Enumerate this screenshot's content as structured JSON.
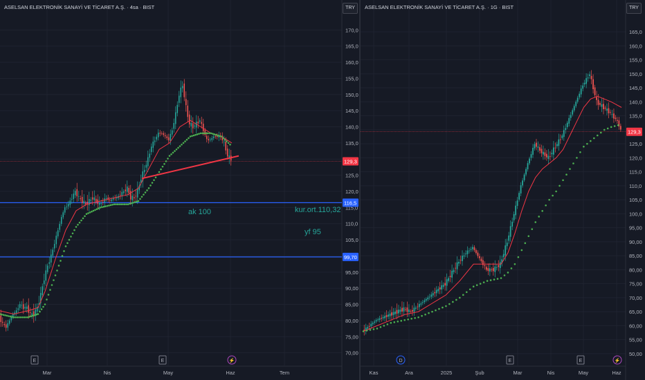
{
  "chart_data": [
    {
      "type": "candlestick",
      "title": "ASELSAN ELEKTRONİK SANAYİ VE TİCARET A.Ş. · 4sa · BIST",
      "currency": "TRY",
      "y_ticks": [
        "70,00",
        "75,00",
        "80,00",
        "85,00",
        "90,00",
        "95,00",
        "100,0",
        "105,0",
        "110,0",
        "115,0",
        "120,0",
        "125,0",
        "130,0",
        "135,0",
        "140,0",
        "145,0",
        "150,0",
        "155,0",
        "160,0",
        "165,0",
        "170,0"
      ],
      "x_ticks": [
        "Mar",
        "Nis",
        "May",
        "Haz",
        "Tem"
      ],
      "ylim": [
        68,
        172
      ],
      "price_markers": [
        {
          "value": 129.3,
          "label": "129,3",
          "color": "#f23645"
        },
        {
          "value": 116.5,
          "label": "116,5",
          "color": "#2962ff"
        },
        {
          "value": 99.7,
          "label": "99,70",
          "color": "#2962ff"
        }
      ],
      "horizontal_lines": [
        116.5,
        99.7
      ],
      "annotations": [
        "ak 100",
        "kur.ort.110,32",
        "yf 95"
      ],
      "event_markers": [
        "E",
        "E",
        "⚡"
      ],
      "close_points": [
        [
          0,
          81
        ],
        [
          5,
          79
        ],
        [
          10,
          78
        ],
        [
          15,
          80
        ],
        [
          20,
          82
        ],
        [
          25,
          83
        ],
        [
          30,
          85
        ],
        [
          35,
          84
        ],
        [
          40,
          84
        ],
        [
          45,
          82
        ],
        [
          50,
          82
        ],
        [
          55,
          84
        ],
        [
          60,
          88
        ],
        [
          65,
          93
        ],
        [
          70,
          97
        ],
        [
          75,
          100
        ],
        [
          80,
          104
        ],
        [
          85,
          108
        ],
        [
          90,
          112
        ],
        [
          95,
          115
        ],
        [
          100,
          116
        ],
        [
          105,
          118
        ],
        [
          110,
          120
        ],
        [
          115,
          118
        ],
        [
          120,
          117
        ],
        [
          125,
          116
        ],
        [
          130,
          117
        ],
        [
          135,
          118
        ],
        [
          140,
          117
        ],
        [
          145,
          116
        ],
        [
          150,
          117
        ],
        [
          155,
          118
        ],
        [
          160,
          117
        ],
        [
          165,
          118
        ],
        [
          170,
          118
        ],
        [
          175,
          119
        ],
        [
          180,
          120
        ],
        [
          185,
          121
        ],
        [
          190,
          118
        ],
        [
          195,
          118
        ],
        [
          200,
          120
        ],
        [
          205,
          124
        ],
        [
          210,
          127
        ],
        [
          215,
          130
        ],
        [
          220,
          134
        ],
        [
          225,
          136
        ],
        [
          230,
          138
        ],
        [
          235,
          138
        ],
        [
          240,
          137
        ],
        [
          245,
          136
        ],
        [
          250,
          139
        ],
        [
          255,
          144
        ],
        [
          260,
          150
        ],
        [
          265,
          153
        ],
        [
          270,
          146
        ],
        [
          275,
          141
        ],
        [
          280,
          140
        ],
        [
          285,
          141
        ],
        [
          290,
          142
        ],
        [
          295,
          139
        ],
        [
          300,
          136
        ],
        [
          305,
          136
        ],
        [
          310,
          137
        ],
        [
          315,
          137
        ],
        [
          320,
          137
        ],
        [
          325,
          135
        ],
        [
          330,
          131
        ],
        [
          335,
          130
        ]
      ],
      "ma_red": [
        [
          0,
          83
        ],
        [
          20,
          82
        ],
        [
          40,
          83
        ],
        [
          55,
          84
        ],
        [
          65,
          89
        ],
        [
          80,
          99
        ],
        [
          95,
          108
        ],
        [
          110,
          114
        ],
        [
          125,
          116
        ],
        [
          145,
          117
        ],
        [
          165,
          118
        ],
        [
          185,
          119
        ],
        [
          200,
          121
        ],
        [
          215,
          127
        ],
        [
          230,
          133
        ],
        [
          245,
          135
        ],
        [
          260,
          140
        ],
        [
          275,
          142
        ],
        [
          290,
          140
        ],
        [
          305,
          138
        ],
        [
          320,
          137
        ],
        [
          335,
          135
        ]
      ],
      "ma_green": [
        [
          0,
          82
        ],
        [
          20,
          81
        ],
        [
          40,
          81
        ],
        [
          55,
          82
        ],
        [
          65,
          85
        ],
        [
          80,
          94
        ],
        [
          95,
          103
        ],
        [
          110,
          109
        ],
        [
          125,
          113
        ],
        [
          145,
          115
        ],
        [
          165,
          116
        ],
        [
          185,
          116
        ],
        [
          200,
          117
        ],
        [
          215,
          121
        ],
        [
          230,
          126
        ],
        [
          245,
          131
        ],
        [
          260,
          134
        ],
        [
          275,
          137
        ],
        [
          290,
          138
        ],
        [
          305,
          138
        ],
        [
          320,
          137
        ],
        [
          335,
          134
        ]
      ],
      "trendline": [
        [
          205,
          124
        ],
        [
          345,
          131
        ]
      ]
    },
    {
      "type": "candlestick",
      "title": "ASELSAN ELEKTRONİK SANAYİ VE TİCARET A.Ş. · 1G · BIST",
      "currency": "TRY",
      "y_ticks": [
        "50,00",
        "55,00",
        "60,00",
        "65,00",
        "70,00",
        "75,00",
        "80,00",
        "85,00",
        "90,00",
        "95,00",
        "100,0",
        "105,0",
        "110,0",
        "115,0",
        "120,0",
        "125,0",
        "130,0",
        "135,0",
        "140,0",
        "145,0",
        "150,0",
        "155,0",
        "160,0",
        "165,0"
      ],
      "x_ticks": [
        "Kas",
        "Ara",
        "2025",
        "Şub",
        "Mar",
        "Nis",
        "May",
        "Haz"
      ],
      "ylim": [
        48,
        168
      ],
      "price_markers": [
        {
          "value": 129.3,
          "label": "129,3",
          "color": "#f23645"
        }
      ],
      "event_markers": [
        "D",
        "E",
        "E",
        "⚡"
      ],
      "close_points": [
        [
          0,
          58
        ],
        [
          10,
          60
        ],
        [
          20,
          62
        ],
        [
          30,
          63
        ],
        [
          40,
          64
        ],
        [
          50,
          65
        ],
        [
          60,
          66
        ],
        [
          70,
          65
        ],
        [
          80,
          67
        ],
        [
          90,
          69
        ],
        [
          100,
          71
        ],
        [
          110,
          73
        ],
        [
          120,
          75
        ],
        [
          130,
          79
        ],
        [
          140,
          83
        ],
        [
          150,
          86
        ],
        [
          160,
          88
        ],
        [
          170,
          84
        ],
        [
          180,
          80
        ],
        [
          190,
          80
        ],
        [
          200,
          82
        ],
        [
          210,
          90
        ],
        [
          220,
          100
        ],
        [
          230,
          110
        ],
        [
          240,
          118
        ],
        [
          250,
          125
        ],
        [
          260,
          122
        ],
        [
          270,
          120
        ],
        [
          280,
          124
        ],
        [
          290,
          128
        ],
        [
          300,
          134
        ],
        [
          310,
          140
        ],
        [
          320,
          146
        ],
        [
          330,
          150
        ],
        [
          340,
          140
        ],
        [
          350,
          138
        ],
        [
          360,
          136
        ],
        [
          370,
          133
        ],
        [
          375,
          130
        ]
      ],
      "ma_red": [
        [
          0,
          58
        ],
        [
          20,
          60
        ],
        [
          40,
          62
        ],
        [
          60,
          64
        ],
        [
          80,
          65
        ],
        [
          100,
          68
        ],
        [
          120,
          71
        ],
        [
          140,
          76
        ],
        [
          160,
          82
        ],
        [
          180,
          82
        ],
        [
          200,
          82
        ],
        [
          210,
          86
        ],
        [
          220,
          93
        ],
        [
          230,
          101
        ],
        [
          240,
          108
        ],
        [
          250,
          113
        ],
        [
          260,
          116
        ],
        [
          270,
          118
        ],
        [
          280,
          120
        ],
        [
          290,
          123
        ],
        [
          300,
          128
        ],
        [
          310,
          133
        ],
        [
          320,
          138
        ],
        [
          330,
          141
        ],
        [
          340,
          142
        ],
        [
          350,
          141
        ],
        [
          360,
          140
        ],
        [
          375,
          138
        ]
      ],
      "ma_green": [
        [
          0,
          58
        ],
        [
          20,
          59
        ],
        [
          40,
          61
        ],
        [
          60,
          62
        ],
        [
          80,
          63
        ],
        [
          100,
          65
        ],
        [
          120,
          67
        ],
        [
          140,
          70
        ],
        [
          160,
          74
        ],
        [
          180,
          76
        ],
        [
          200,
          77
        ],
        [
          210,
          79
        ],
        [
          220,
          82
        ],
        [
          230,
          87
        ],
        [
          240,
          92
        ],
        [
          250,
          97
        ],
        [
          260,
          101
        ],
        [
          270,
          105
        ],
        [
          280,
          108
        ],
        [
          290,
          112
        ],
        [
          300,
          116
        ],
        [
          310,
          120
        ],
        [
          320,
          124
        ],
        [
          330,
          126
        ],
        [
          340,
          128
        ],
        [
          350,
          130
        ],
        [
          360,
          131
        ],
        [
          375,
          132
        ]
      ]
    }
  ]
}
